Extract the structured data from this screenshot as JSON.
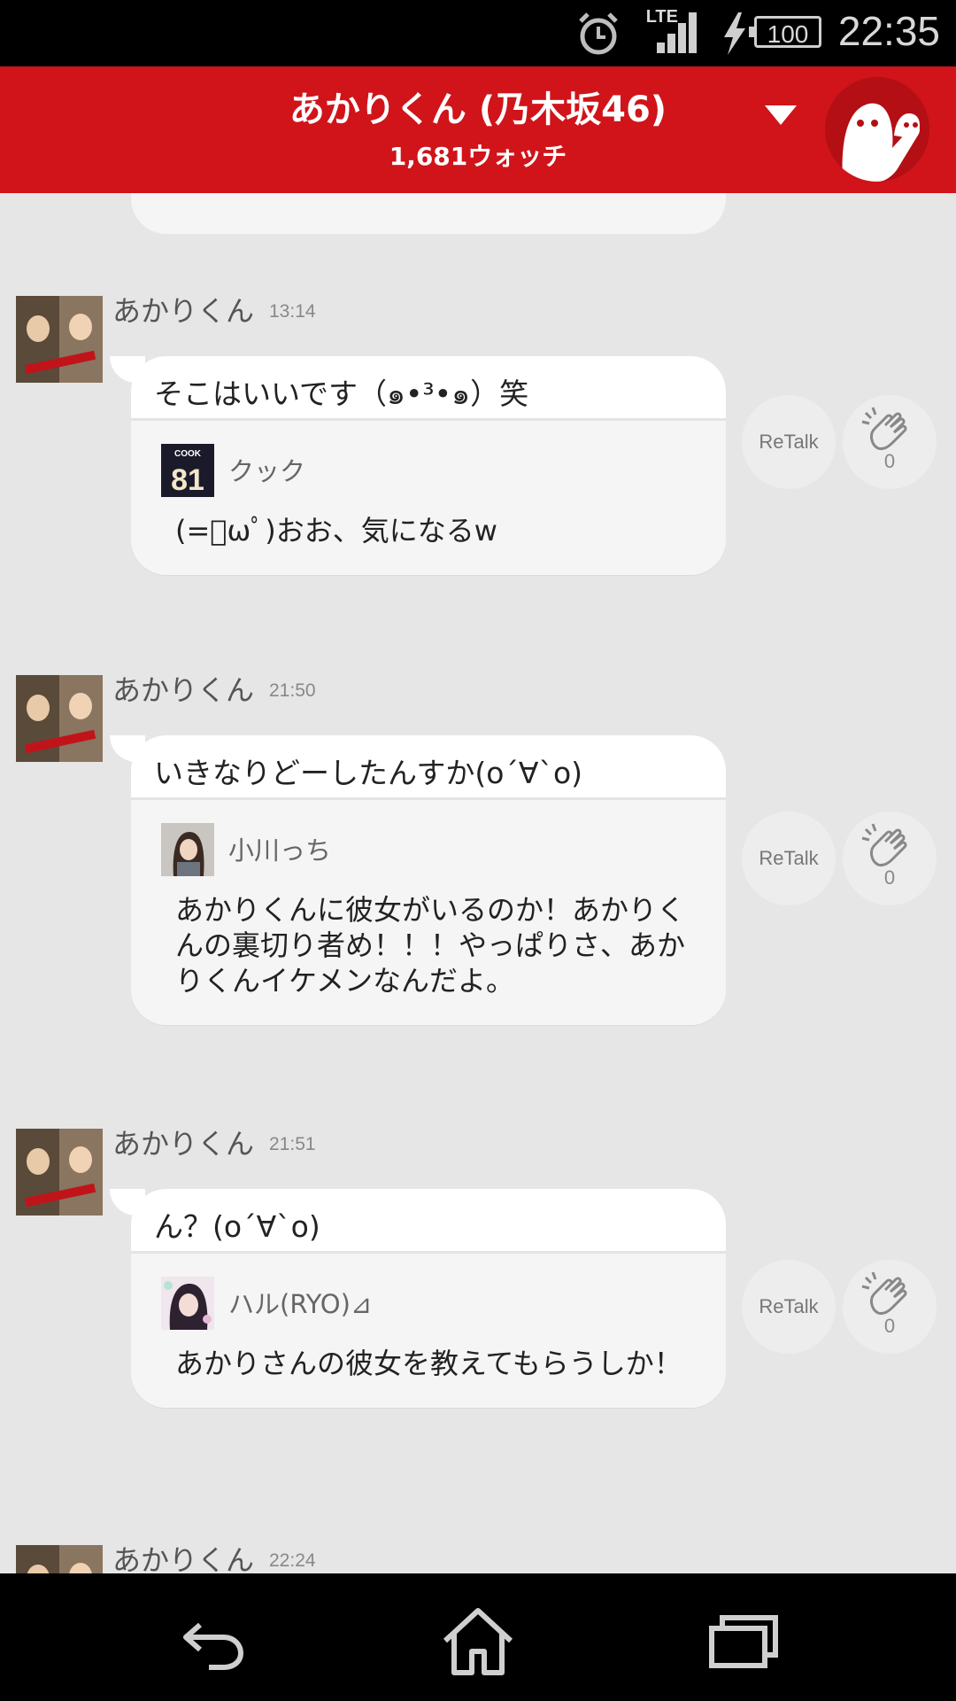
{
  "status_bar": {
    "time": "22:35",
    "battery": "100",
    "network": "LTE",
    "icons": [
      "alarm-icon",
      "signal-icon",
      "charging-icon",
      "battery-icon"
    ]
  },
  "header": {
    "title": "あかりくん (乃木坂46)",
    "watch_count": "1,681ウォッチ",
    "color": "#d0141a",
    "icons": [
      "dropdown-triangle-icon",
      "mascot-icon"
    ]
  },
  "messages": [
    {
      "author": "あかりくん",
      "time": "13:14",
      "text": "そこはいいです（๑•³•๑）笑",
      "quote": {
        "user": "クック",
        "text": "(=ﾟωﾟ)おお、気になるw"
      },
      "retalk_label": "ReTalk",
      "clap_count": "0"
    },
    {
      "author": "あかりくん",
      "time": "21:50",
      "text": "いきなりどーしたんすか(o´∀`o)",
      "quote": {
        "user": "小川っち",
        "text": "あかりくんに彼女がいるのか！あかりくんの裏切り者め！！！やっぱりさ、あかりくんイケメンなんだよ。"
      },
      "retalk_label": "ReTalk",
      "clap_count": "0"
    },
    {
      "author": "あかりくん",
      "time": "21:51",
      "text": "ん？(o´∀`o)",
      "quote": {
        "user": "ハル(RYO)⊿",
        "text": "あかりさんの彼女を教えてもらうしか！"
      },
      "retalk_label": "ReTalk",
      "clap_count": "0"
    },
    {
      "author": "あかりくん",
      "time": "22:24"
    }
  ],
  "quote_avatar_labels": {
    "cook": "COOK",
    "cook_number": "81"
  },
  "nav_bar": {
    "icons": [
      "back-icon",
      "home-icon",
      "recent-apps-icon"
    ]
  }
}
